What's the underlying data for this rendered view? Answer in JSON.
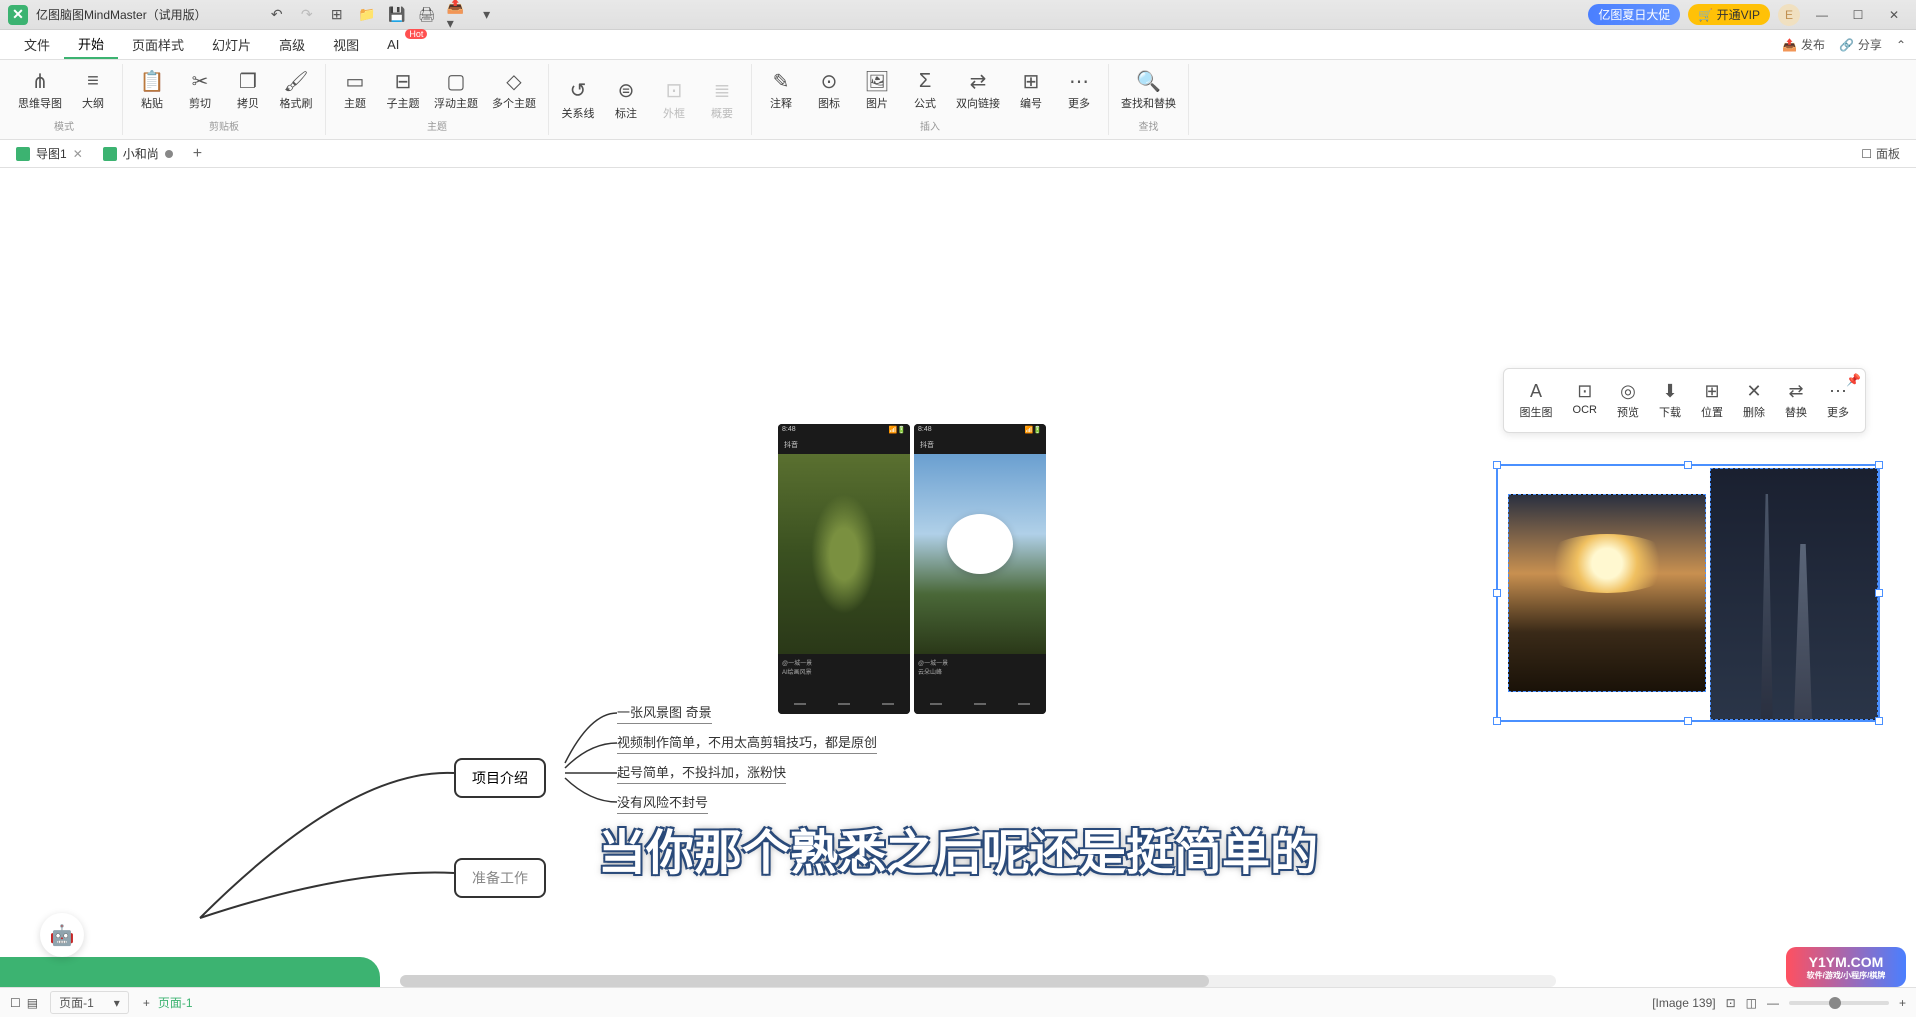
{
  "titlebar": {
    "app_name": "亿图脑图MindMaster（试用版）",
    "promo": "亿图夏日大促",
    "vip": "🛒 开通VIP",
    "user_initial": "E"
  },
  "menu": {
    "items": [
      "文件",
      "开始",
      "页面样式",
      "幻灯片",
      "高级",
      "视图",
      "AI"
    ],
    "active_index": 1,
    "hot_label": "Hot",
    "publish": "发布",
    "share": "分享"
  },
  "ribbon": {
    "groups": [
      {
        "label": "模式",
        "items": [
          {
            "icon": "⋔",
            "text": "思维导图"
          },
          {
            "icon": "≡",
            "text": "大纲"
          }
        ]
      },
      {
        "label": "剪贴板",
        "items": [
          {
            "icon": "📋",
            "text": "粘贴"
          },
          {
            "icon": "✂",
            "text": "剪切"
          },
          {
            "icon": "❐",
            "text": "拷贝"
          },
          {
            "icon": "🖌",
            "text": "格式刷"
          }
        ]
      },
      {
        "label": "主题",
        "items": [
          {
            "icon": "▭",
            "text": "主题"
          },
          {
            "icon": "⊟",
            "text": "子主题"
          },
          {
            "icon": "▢",
            "text": "浮动主题"
          },
          {
            "icon": "◇",
            "text": "多个主题"
          }
        ]
      },
      {
        "label": "",
        "items": [
          {
            "icon": "↺",
            "text": "关系线"
          },
          {
            "icon": "⊜",
            "text": "标注"
          },
          {
            "icon": "⊡",
            "text": "外框",
            "disabled": true
          },
          {
            "icon": "≣",
            "text": "概要",
            "disabled": true
          }
        ]
      },
      {
        "label": "插入",
        "items": [
          {
            "icon": "✎",
            "text": "注释"
          },
          {
            "icon": "⊙",
            "text": "图标"
          },
          {
            "icon": "🖼",
            "text": "图片"
          },
          {
            "icon": "Σ",
            "text": "公式"
          },
          {
            "icon": "⇄",
            "text": "双向链接"
          },
          {
            "icon": "⊞",
            "text": "编号"
          },
          {
            "icon": "⋯",
            "text": "更多"
          }
        ]
      },
      {
        "label": "查找",
        "items": [
          {
            "icon": "🔍",
            "text": "查找和替换"
          }
        ]
      }
    ]
  },
  "doc_tabs": {
    "tabs": [
      {
        "name": "导图1",
        "has_close": true
      },
      {
        "name": "小和尚",
        "has_dot": true
      }
    ],
    "panel": "面板"
  },
  "float_toolbar": {
    "items": [
      {
        "icon": "A",
        "text": "图生图"
      },
      {
        "icon": "⊡",
        "text": "OCR"
      },
      {
        "icon": "◎",
        "text": "预览"
      },
      {
        "icon": "⬇",
        "text": "下载"
      },
      {
        "icon": "⊞",
        "text": "位置"
      },
      {
        "icon": "✕",
        "text": "删除"
      },
      {
        "icon": "⇄",
        "text": "替换"
      },
      {
        "icon": "⋯",
        "text": "更多"
      }
    ]
  },
  "mindmap": {
    "main": "项目介绍",
    "node2": "准备工作",
    "subs": [
      "一张风景图  奇景",
      "视频制作简单，不用太高剪辑技巧，都是原创",
      "起号简单，不投抖加，涨粉快",
      "没有风险不封号"
    ]
  },
  "subtitle": "当你那个熟悉之后呢还是挺简单的",
  "statusbar": {
    "page_selector": "页面-1",
    "page_current": "页面-1",
    "image_info": "[Image 139]",
    "zoom": "— —◯— +"
  },
  "watermark": {
    "main": "Y1YM.COM",
    "sub": "软件/游戏/小程序/棋牌"
  }
}
